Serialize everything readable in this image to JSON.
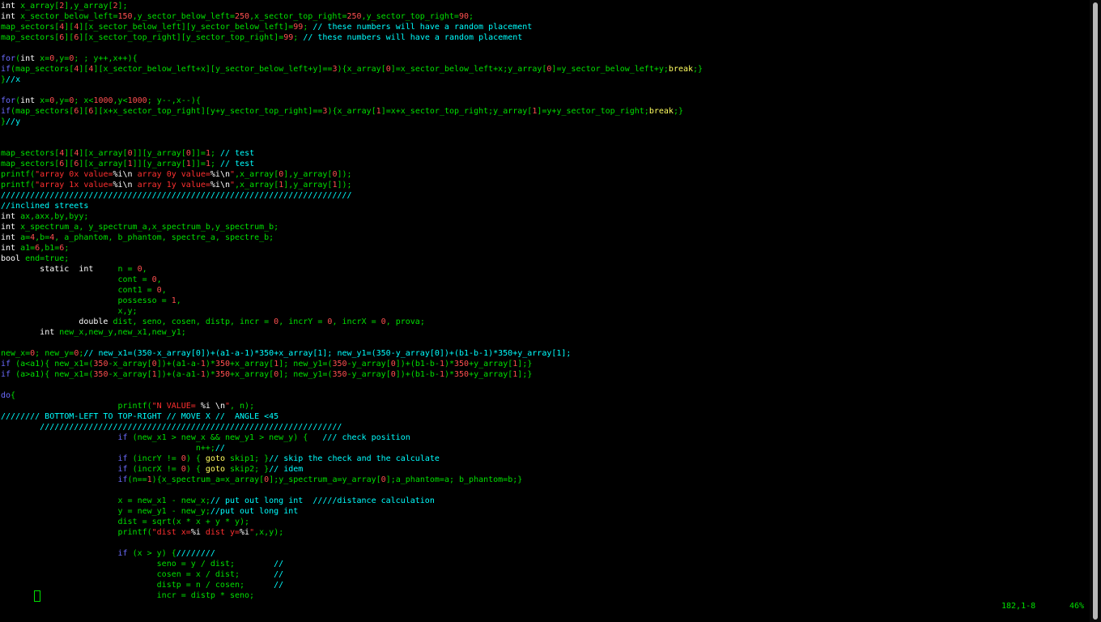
{
  "editor": {
    "colors": {
      "background": "#000000",
      "type": "#ffffff",
      "keyword": "#6c6cff",
      "number": "#ff5050",
      "string": "#ff3030",
      "comment": "#00ffff",
      "identifier": "#00e000",
      "break_keyword": "#ffff60"
    },
    "lines": [
      [
        [
          "type",
          "int"
        ],
        [
          "id",
          " x_array["
        ],
        [
          "num",
          "2"
        ],
        [
          "id",
          "],y_array["
        ],
        [
          "num",
          "2"
        ],
        [
          "id",
          "];"
        ]
      ],
      [
        [
          "type",
          "int"
        ],
        [
          "id",
          " x_sector_below_left="
        ],
        [
          "num",
          "150"
        ],
        [
          "id",
          ",y_sector_below_left="
        ],
        [
          "num",
          "250"
        ],
        [
          "id",
          ",x_sector_top_right="
        ],
        [
          "num",
          "250"
        ],
        [
          "id",
          ",y_sector_top_right="
        ],
        [
          "num",
          "90"
        ],
        [
          "id",
          ";"
        ]
      ],
      [
        [
          "id",
          "map_sectors["
        ],
        [
          "num",
          "4"
        ],
        [
          "id",
          "]["
        ],
        [
          "num",
          "4"
        ],
        [
          "id",
          "][x_sector_below_left][y_sector_below_left]="
        ],
        [
          "num",
          "99"
        ],
        [
          "id",
          "; "
        ],
        [
          "cmt",
          "// these numbers will have a random placement"
        ]
      ],
      [
        [
          "id",
          "map_sectors["
        ],
        [
          "num",
          "6"
        ],
        [
          "id",
          "]["
        ],
        [
          "num",
          "6"
        ],
        [
          "id",
          "][x_sector_top_right][y_sector_top_right]="
        ],
        [
          "num",
          "99"
        ],
        [
          "id",
          "; "
        ],
        [
          "cmt",
          "// these numbers will have a random placement"
        ]
      ],
      [],
      [
        [
          "kw",
          "for"
        ],
        [
          "id",
          "("
        ],
        [
          "type",
          "int"
        ],
        [
          "id",
          " x="
        ],
        [
          "num",
          "0"
        ],
        [
          "id",
          ",y="
        ],
        [
          "num",
          "0"
        ],
        [
          "id",
          "; ; y++,x++){"
        ]
      ],
      [
        [
          "kw",
          "if"
        ],
        [
          "id",
          "(map_sectors["
        ],
        [
          "num",
          "4"
        ],
        [
          "id",
          "]["
        ],
        [
          "num",
          "4"
        ],
        [
          "id",
          "][x_sector_below_left+x][y_sector_below_left+y]=="
        ],
        [
          "num",
          "3"
        ],
        [
          "id",
          "){x_array["
        ],
        [
          "num",
          "0"
        ],
        [
          "id",
          "]=x_sector_below_left+x;y_array["
        ],
        [
          "num",
          "0"
        ],
        [
          "id",
          "]=y_sector_below_left+y;"
        ],
        [
          "brk",
          "break"
        ],
        [
          "id",
          ";}"
        ]
      ],
      [
        [
          "id",
          "}"
        ],
        [
          "cmt",
          "//x"
        ]
      ],
      [],
      [
        [
          "kw",
          "for"
        ],
        [
          "id",
          "("
        ],
        [
          "type",
          "int"
        ],
        [
          "id",
          " x="
        ],
        [
          "num",
          "0"
        ],
        [
          "id",
          ",y="
        ],
        [
          "num",
          "0"
        ],
        [
          "id",
          "; x<"
        ],
        [
          "num",
          "1000"
        ],
        [
          "id",
          ",y<"
        ],
        [
          "num",
          "1000"
        ],
        [
          "id",
          "; y--,x--){"
        ]
      ],
      [
        [
          "kw",
          "if"
        ],
        [
          "id",
          "(map_sectors["
        ],
        [
          "num",
          "6"
        ],
        [
          "id",
          "]["
        ],
        [
          "num",
          "6"
        ],
        [
          "id",
          "][x+x_sector_top_right][y+y_sector_top_right]=="
        ],
        [
          "num",
          "3"
        ],
        [
          "id",
          "){x_array["
        ],
        [
          "num",
          "1"
        ],
        [
          "id",
          "]=x+x_sector_top_right;y_array["
        ],
        [
          "num",
          "1"
        ],
        [
          "id",
          "]=y+y_sector_top_right;"
        ],
        [
          "brk",
          "break"
        ],
        [
          "id",
          ";}"
        ]
      ],
      [
        [
          "id",
          "}"
        ],
        [
          "cmt",
          "//y"
        ]
      ],
      [],
      [],
      [
        [
          "id",
          "map_sectors["
        ],
        [
          "num",
          "4"
        ],
        [
          "id",
          "]["
        ],
        [
          "num",
          "4"
        ],
        [
          "id",
          "][x_array["
        ],
        [
          "num",
          "0"
        ],
        [
          "id",
          "]][y_array["
        ],
        [
          "num",
          "0"
        ],
        [
          "id",
          "]]="
        ],
        [
          "num",
          "1"
        ],
        [
          "id",
          "; "
        ],
        [
          "cmt",
          "// test"
        ]
      ],
      [
        [
          "id",
          "map_sectors["
        ],
        [
          "num",
          "6"
        ],
        [
          "id",
          "]["
        ],
        [
          "num",
          "6"
        ],
        [
          "id",
          "][x_array["
        ],
        [
          "num",
          "1"
        ],
        [
          "id",
          "]][y_array["
        ],
        [
          "num",
          "1"
        ],
        [
          "id",
          "]]="
        ],
        [
          "num",
          "1"
        ],
        [
          "id",
          "; "
        ],
        [
          "cmt",
          "// test"
        ]
      ],
      [
        [
          "id",
          "printf("
        ],
        [
          "str",
          "\"array 0x value="
        ],
        [
          "esc",
          "%i\\n"
        ],
        [
          "str",
          " array 0y value="
        ],
        [
          "esc",
          "%i\\n"
        ],
        [
          "str",
          "\""
        ],
        [
          "id",
          ",x_array["
        ],
        [
          "num",
          "0"
        ],
        [
          "id",
          "],y_array["
        ],
        [
          "num",
          "0"
        ],
        [
          "id",
          "]);"
        ]
      ],
      [
        [
          "id",
          "printf("
        ],
        [
          "str",
          "\"array 1x value="
        ],
        [
          "esc",
          "%i\\n"
        ],
        [
          "str",
          " array 1y value="
        ],
        [
          "esc",
          "%i\\n"
        ],
        [
          "str",
          "\""
        ],
        [
          "id",
          ",x_array["
        ],
        [
          "num",
          "1"
        ],
        [
          "id",
          "],y_array["
        ],
        [
          "num",
          "1"
        ],
        [
          "id",
          "]);"
        ]
      ],
      [
        [
          "cmt",
          "////////////////////////////////////////////////////////////////////////"
        ]
      ],
      [
        [
          "cmt",
          "//inclined streets"
        ]
      ],
      [
        [
          "type",
          "int"
        ],
        [
          "id",
          " ax,axx,by,byy;"
        ]
      ],
      [
        [
          "type",
          "int"
        ],
        [
          "id",
          " x_spectrum_a, y_spectrum_a,x_spectrum_b,y_spectrum_b;"
        ]
      ],
      [
        [
          "type",
          "int"
        ],
        [
          "id",
          " a="
        ],
        [
          "num",
          "4"
        ],
        [
          "id",
          ",b="
        ],
        [
          "num",
          "4"
        ],
        [
          "id",
          ", a_phantom, b_phantom, spectre_a, spectre_b;"
        ]
      ],
      [
        [
          "type",
          "int"
        ],
        [
          "id",
          " a1="
        ],
        [
          "num",
          "6"
        ],
        [
          "id",
          ",b1="
        ],
        [
          "num",
          "6"
        ],
        [
          "id",
          ";"
        ]
      ],
      [
        [
          "type",
          "bool"
        ],
        [
          "id",
          " end="
        ],
        [
          "id",
          "true"
        ],
        [
          "id",
          ";"
        ]
      ],
      [
        [
          "id",
          "        "
        ],
        [
          "type",
          "static  int"
        ],
        [
          "id",
          "     n = "
        ],
        [
          "num",
          "0"
        ],
        [
          "id",
          ","
        ]
      ],
      [
        [
          "id",
          "                        cont = "
        ],
        [
          "num",
          "0"
        ],
        [
          "id",
          ","
        ]
      ],
      [
        [
          "id",
          "                        cont1 = "
        ],
        [
          "num",
          "0"
        ],
        [
          "id",
          ","
        ]
      ],
      [
        [
          "id",
          "                        possesso = "
        ],
        [
          "num",
          "1"
        ],
        [
          "id",
          ","
        ]
      ],
      [
        [
          "id",
          "                        x,y;"
        ]
      ],
      [
        [
          "id",
          "                "
        ],
        [
          "type",
          "double"
        ],
        [
          "id",
          " dist, seno, cosen, distp, incr = "
        ],
        [
          "num",
          "0"
        ],
        [
          "id",
          ", incrY = "
        ],
        [
          "num",
          "0"
        ],
        [
          "id",
          ", incrX = "
        ],
        [
          "num",
          "0"
        ],
        [
          "id",
          ", prova;"
        ]
      ],
      [
        [
          "id",
          "        "
        ],
        [
          "type",
          "int"
        ],
        [
          "id",
          " new_x,new_y,new_x1,new_y1;"
        ]
      ],
      [],
      [
        [
          "id",
          "new_x="
        ],
        [
          "num",
          "0"
        ],
        [
          "id",
          "; new_y="
        ],
        [
          "num",
          "0"
        ],
        [
          "id",
          ";"
        ],
        [
          "cmt",
          "// new_x1=(350-x_array[0])+(a1-a-1)*350+x_array[1]; new_y1=(350-y_array[0])+(b1-b-1)*350+y_array[1];"
        ]
      ],
      [
        [
          "kw",
          "if"
        ],
        [
          "id",
          " (a<a1){ new_x1=("
        ],
        [
          "num",
          "350"
        ],
        [
          "id",
          "-x_array["
        ],
        [
          "num",
          "0"
        ],
        [
          "id",
          "])+(a1-a-"
        ],
        [
          "num",
          "1"
        ],
        [
          "id",
          ")*"
        ],
        [
          "num",
          "350"
        ],
        [
          "id",
          "+x_array["
        ],
        [
          "num",
          "1"
        ],
        [
          "id",
          "]; new_y1=("
        ],
        [
          "num",
          "350"
        ],
        [
          "id",
          "-y_array["
        ],
        [
          "num",
          "0"
        ],
        [
          "id",
          "])+(b1-b-"
        ],
        [
          "num",
          "1"
        ],
        [
          "id",
          ")*"
        ],
        [
          "num",
          "350"
        ],
        [
          "id",
          "+y_array["
        ],
        [
          "num",
          "1"
        ],
        [
          "id",
          "];}"
        ]
      ],
      [
        [
          "kw",
          "if"
        ],
        [
          "id",
          " (a>a1){ new_x1=("
        ],
        [
          "num",
          "350"
        ],
        [
          "id",
          "-x_array["
        ],
        [
          "num",
          "1"
        ],
        [
          "id",
          "])+(a-a1-"
        ],
        [
          "num",
          "1"
        ],
        [
          "id",
          ")*"
        ],
        [
          "num",
          "350"
        ],
        [
          "id",
          "+x_array["
        ],
        [
          "num",
          "0"
        ],
        [
          "id",
          "]; new_y1=("
        ],
        [
          "num",
          "350"
        ],
        [
          "id",
          "-y_array["
        ],
        [
          "num",
          "0"
        ],
        [
          "id",
          "])+(b1-b-"
        ],
        [
          "num",
          "1"
        ],
        [
          "id",
          ")*"
        ],
        [
          "num",
          "350"
        ],
        [
          "id",
          "+y_array["
        ],
        [
          "num",
          "1"
        ],
        [
          "id",
          "];}"
        ]
      ],
      [],
      [
        [
          "kw",
          "do"
        ],
        [
          "id",
          "{"
        ]
      ],
      [
        [
          "id",
          "                        printf("
        ],
        [
          "str",
          "\"N VALUE= "
        ],
        [
          "esc",
          "%i \\n"
        ],
        [
          "str",
          "\""
        ],
        [
          "id",
          ", n);"
        ]
      ],
      [
        [
          "cmt",
          "//////// BOTTOM-LEFT TO TOP-RIGHT // MOVE X //  ANGLE <45"
        ]
      ],
      [
        [
          "id",
          "        "
        ],
        [
          "cmt",
          "//////////////////////////////////////////////////////////////"
        ]
      ],
      [
        [
          "id",
          "                        "
        ],
        [
          "kw",
          "if"
        ],
        [
          "id",
          " (new_x1 > new_x && new_y1 > new_y) {   "
        ],
        [
          "cmt",
          "/// check position"
        ]
      ],
      [
        [
          "id",
          "                                        n++;"
        ],
        [
          "cmt",
          "//"
        ]
      ],
      [
        [
          "id",
          "                        "
        ],
        [
          "kw",
          "if"
        ],
        [
          "id",
          " (incrY != "
        ],
        [
          "num",
          "0"
        ],
        [
          "id",
          ") { "
        ],
        [
          "brk",
          "goto"
        ],
        [
          "id",
          " skip1; }"
        ],
        [
          "cmt",
          "// skip the check and the calculate"
        ]
      ],
      [
        [
          "id",
          "                        "
        ],
        [
          "kw",
          "if"
        ],
        [
          "id",
          " (incrX != "
        ],
        [
          "num",
          "0"
        ],
        [
          "id",
          ") { "
        ],
        [
          "brk",
          "goto"
        ],
        [
          "id",
          " skip2; }"
        ],
        [
          "cmt",
          "// idem"
        ]
      ],
      [
        [
          "id",
          "                        "
        ],
        [
          "kw",
          "if"
        ],
        [
          "id",
          "(n=="
        ],
        [
          "num",
          "1"
        ],
        [
          "id",
          "){x_spectrum_a=x_array["
        ],
        [
          "num",
          "0"
        ],
        [
          "id",
          "];y_spectrum_a=y_array["
        ],
        [
          "num",
          "0"
        ],
        [
          "id",
          "];a_phantom=a; b_phantom=b;}"
        ]
      ],
      [],
      [
        [
          "id",
          "                        x = new_x1 - new_x;"
        ],
        [
          "cmt",
          "// put out long int  /////distance calculation"
        ]
      ],
      [
        [
          "id",
          "                        y = new_y1 - new_y;"
        ],
        [
          "cmt",
          "//put out long int"
        ]
      ],
      [
        [
          "id",
          "                        dist = sqrt(x * x + y * y);"
        ]
      ],
      [
        [
          "id",
          "                        printf("
        ],
        [
          "str",
          "\"dist x="
        ],
        [
          "esc",
          "%i"
        ],
        [
          "str",
          " dist y="
        ],
        [
          "esc",
          "%i"
        ],
        [
          "str",
          "\""
        ],
        [
          "id",
          ",x,y);"
        ]
      ],
      [],
      [
        [
          "id",
          "                        "
        ],
        [
          "kw",
          "if"
        ],
        [
          "id",
          " (x > y) {"
        ],
        [
          "cmt",
          "////////"
        ]
      ],
      [
        [
          "id",
          "                                seno = y / dist;        "
        ],
        [
          "cmt",
          "//"
        ]
      ],
      [
        [
          "id",
          "                                cosen = x / dist;       "
        ],
        [
          "cmt",
          "//"
        ]
      ],
      [
        [
          "id",
          "                                distp = n / cosen;      "
        ],
        [
          "cmt",
          "//"
        ]
      ],
      [
        [
          "id",
          "                                incr = distp * seno;"
        ]
      ]
    ]
  },
  "status": {
    "position": "182,1-8",
    "percent": "46%"
  },
  "cursor": {
    "icon": "block-cursor-icon"
  }
}
